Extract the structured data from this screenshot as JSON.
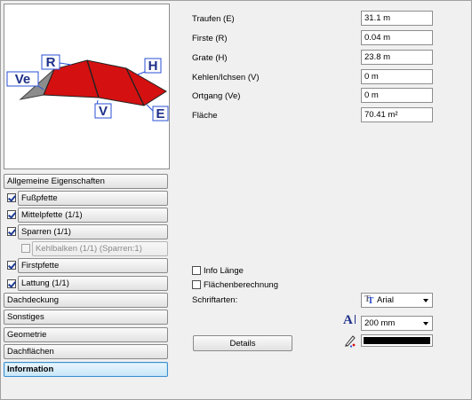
{
  "preview": {
    "labels": {
      "ve": "Ve",
      "r": "R",
      "h": "H",
      "v": "V",
      "e": "E"
    },
    "roof_color": "#d41010"
  },
  "sidebar": {
    "items": [
      {
        "label": "Allgemeine Eigenschaften"
      },
      {
        "label": "Fußpfette",
        "checked": true
      },
      {
        "label": "Mittelpfette (1/1)",
        "checked": true
      },
      {
        "label": "Sparren (1/1)",
        "checked": true
      },
      {
        "label": "Kehlbalken (1/1) (Sparren:1)",
        "checked": false,
        "disabled": true
      },
      {
        "label": "Firstpfette",
        "checked": true
      },
      {
        "label": "Lattung (1/1)",
        "checked": true
      },
      {
        "label": "Dachdeckung"
      },
      {
        "label": "Sonstiges"
      },
      {
        "label": "Geometrie"
      },
      {
        "label": "Dachflächen"
      },
      {
        "label": "Information",
        "active": true
      }
    ]
  },
  "info": {
    "rows": [
      {
        "label": "Traufen (E)",
        "value": "31.1 m"
      },
      {
        "label": "Firste (R)",
        "value": "0.04 m"
      },
      {
        "label": "Grate (H)",
        "value": "23.8 m"
      },
      {
        "label": "Kehlen/Ichsen (V)",
        "value": "0 m"
      },
      {
        "label": "Ortgang (Ve)",
        "value": "0 m"
      },
      {
        "label": "Fläche",
        "value": "70.41 m²"
      }
    ]
  },
  "options": {
    "info_length_label": "Info Länge",
    "info_length_checked": false,
    "area_calc_label": "Flächenberechnung",
    "area_calc_checked": false,
    "fonts_label": "Schriftarten:",
    "font_value": "Arial",
    "size_value": "200 mm",
    "color_value": "#000000",
    "details_label": "Details"
  }
}
